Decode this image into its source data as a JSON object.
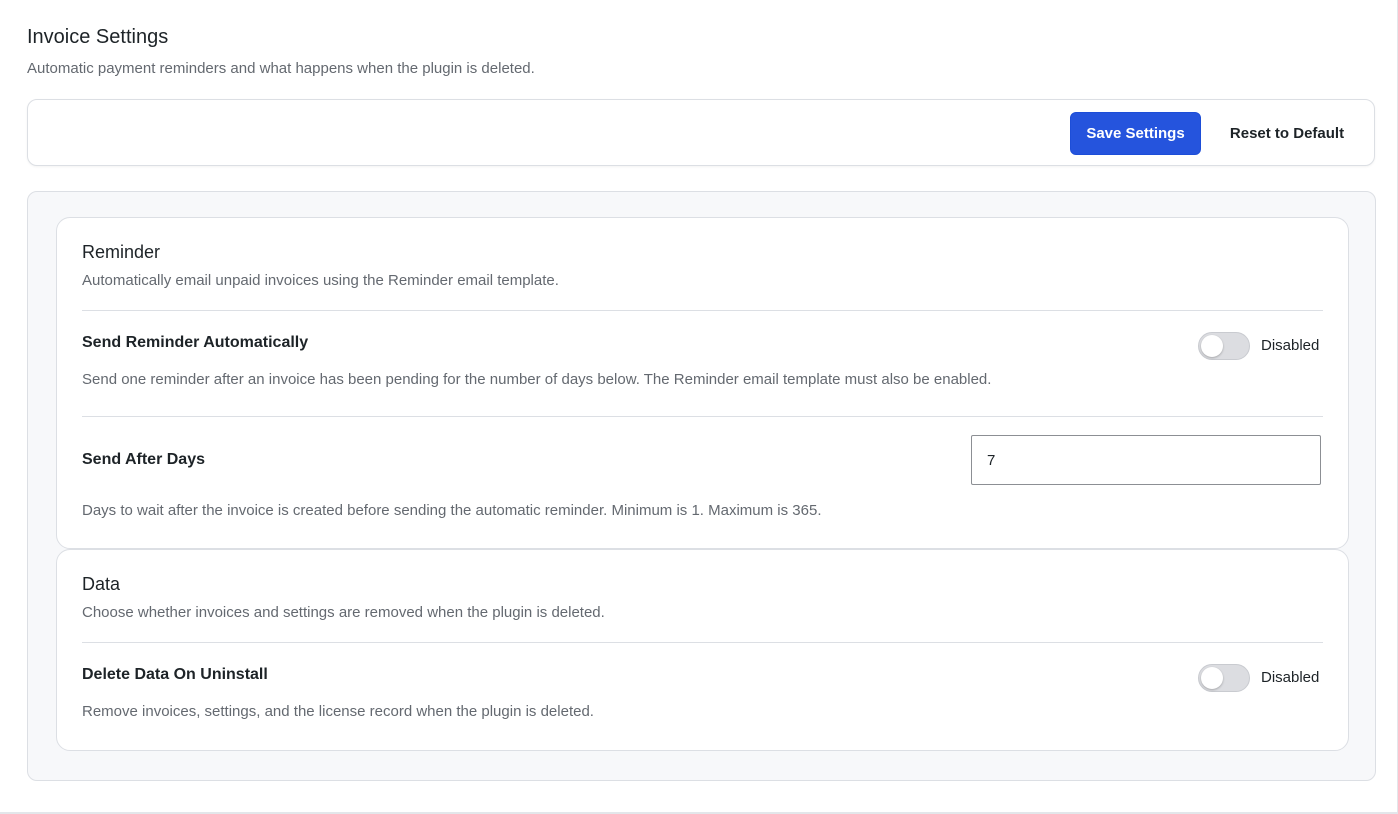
{
  "header": {
    "title": "Invoice Settings",
    "subtitle": "Automatic payment reminders and what happens when the plugin is deleted."
  },
  "toolbar": {
    "save_label": "Save Settings",
    "reset_label": "Reset to Default"
  },
  "colors": {
    "accent": "#2554dd",
    "toggle_off": "#dcdde1"
  },
  "reminder": {
    "title": "Reminder",
    "description": "Automatically email unpaid invoices using the Reminder email template.",
    "send_reminder": {
      "label": "Send Reminder Automatically",
      "help": "Send one reminder after an invoice has been pending for the number of days below. The Reminder email template must also be enabled.",
      "enabled": false,
      "status": "Disabled"
    },
    "send_after_days": {
      "label": "Send After Days",
      "value": "7",
      "help": "Days to wait after the invoice is created before sending the automatic reminder. Minimum is 1. Maximum is 365."
    }
  },
  "data_section": {
    "title": "Data",
    "description": "Choose whether invoices and settings are removed when the plugin is deleted.",
    "delete_on_uninstall": {
      "label": "Delete Data On Uninstall",
      "help": "Remove invoices, settings, and the license record when the plugin is deleted.",
      "enabled": false,
      "status": "Disabled"
    }
  }
}
